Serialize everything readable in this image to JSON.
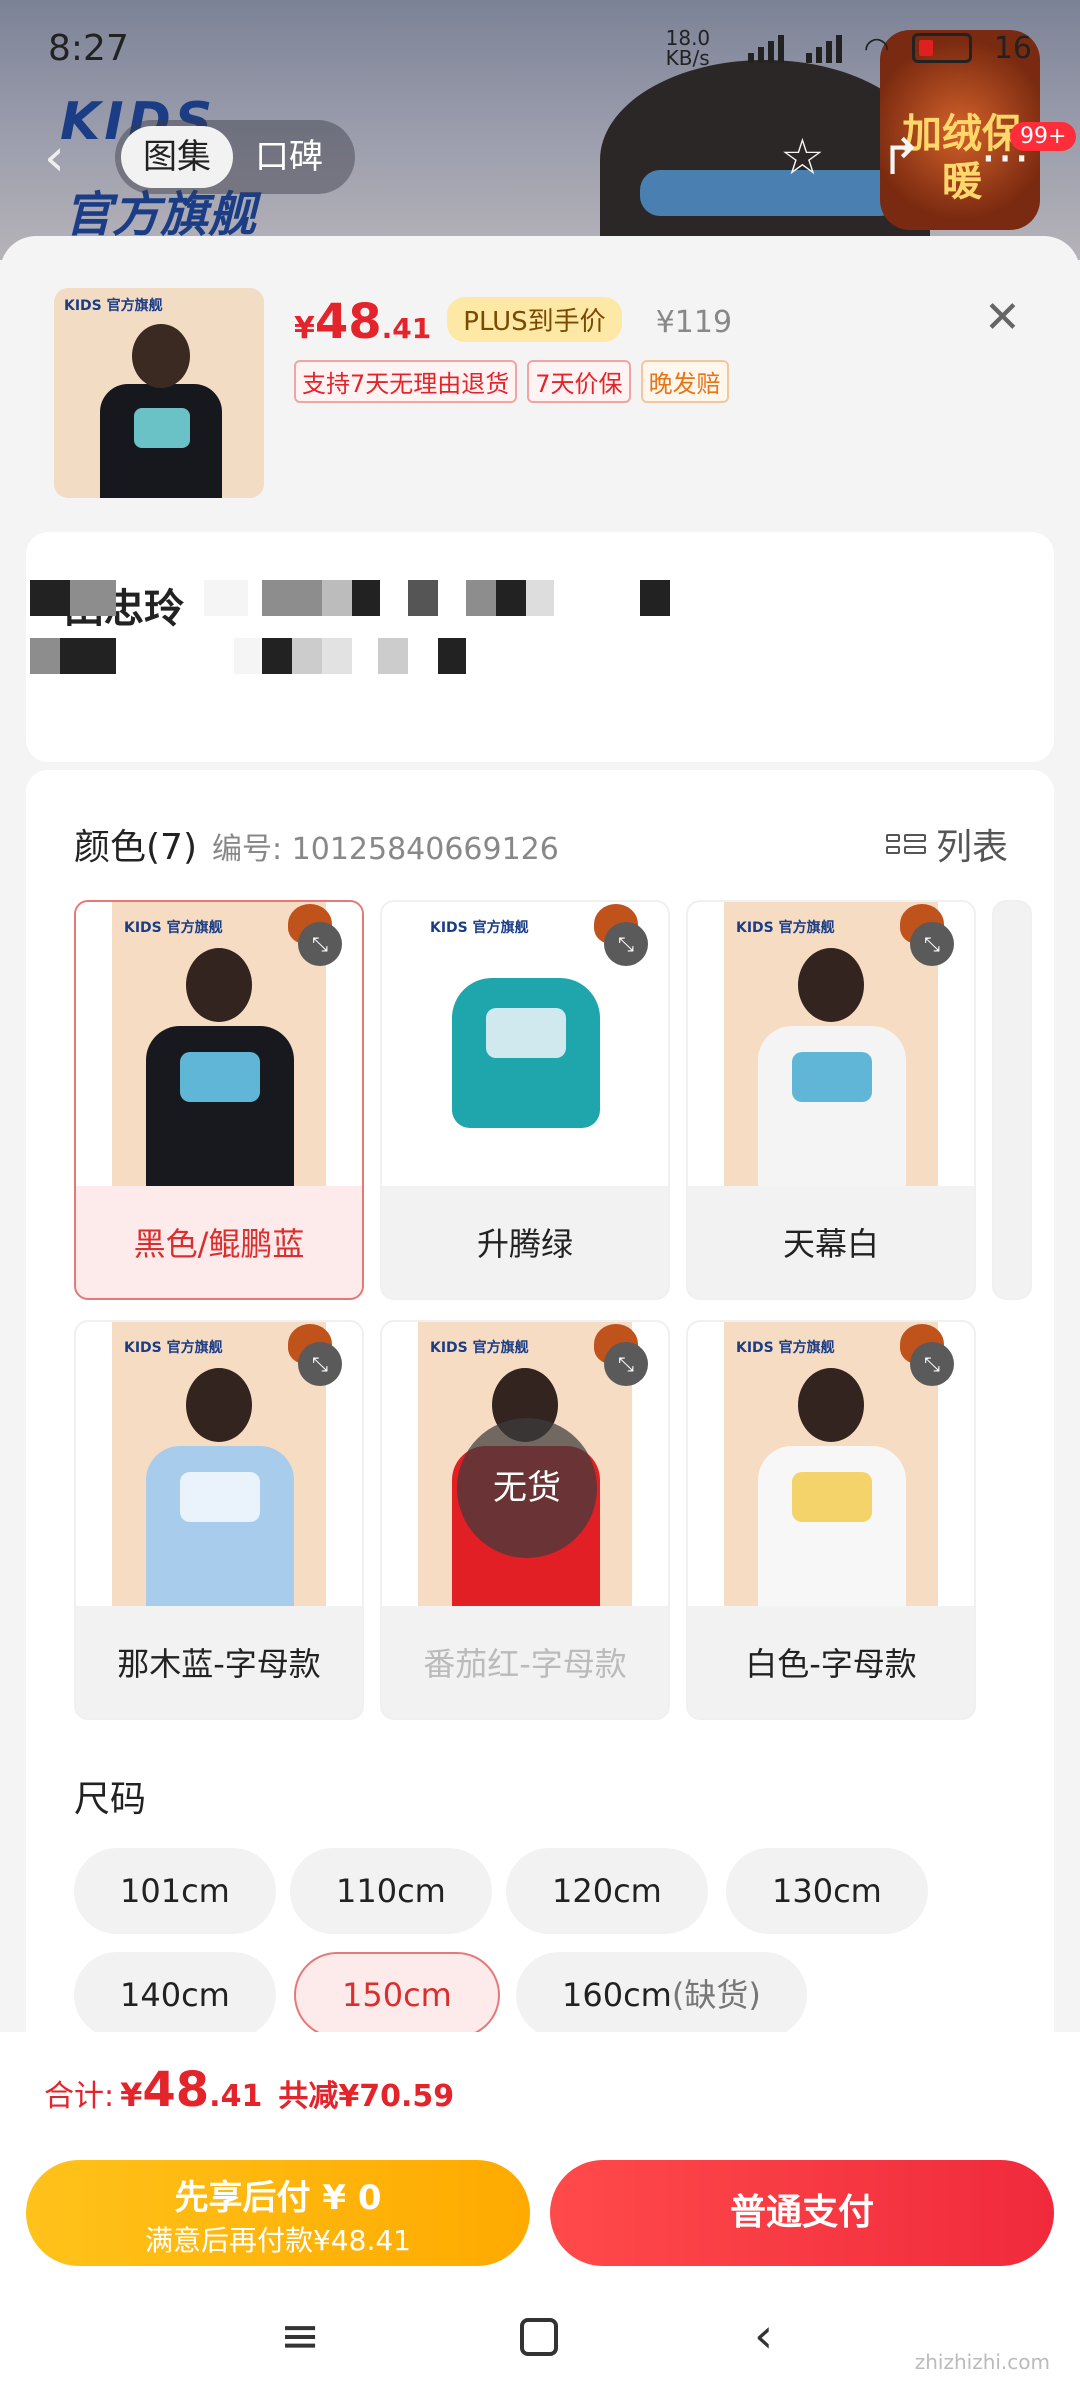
{
  "status_bar": {
    "time": "8:27",
    "net_speed": "18.0 KB/s",
    "battery": "16"
  },
  "top_nav": {
    "tabs": [
      {
        "label": "图集",
        "active": true
      },
      {
        "label": "口碑",
        "active": false
      }
    ],
    "notification_count": "99+",
    "icons": [
      "back-icon",
      "star-icon",
      "share-icon",
      "more-icon"
    ]
  },
  "background_banner": {
    "brand_line1": "KIDS",
    "brand_line2": "官方旗舰",
    "badge_text": "加绒保暖"
  },
  "product": {
    "price_symbol": "¥",
    "price_int": "48",
    "price_dec": ".41",
    "plus_label": "PLUS到手价",
    "original_price": "¥119",
    "tags": [
      "支持7天无理由退货",
      "7天价保",
      "晚发赔"
    ],
    "thumb_brand": "KIDS 官方旗舰"
  },
  "address": {
    "label": "田忠玲"
  },
  "color_section": {
    "title": "颜色(7)",
    "sku_label": "编号: 10125840669126",
    "list_toggle_label": "列表",
    "options": [
      {
        "label": "黑色/鲲鹏蓝",
        "selected": true,
        "available": true,
        "shirt_color": "#17191e"
      },
      {
        "label": "升腾绿",
        "selected": false,
        "available": true,
        "shirt_color": "#1fa6ad"
      },
      {
        "label": "天幕白",
        "selected": false,
        "available": true,
        "shirt_color": "#f4f4f4"
      },
      {
        "label": "那木蓝-字母款",
        "selected": false,
        "available": true,
        "shirt_color": "#a8cdec"
      },
      {
        "label": "番茄红-字母款",
        "selected": false,
        "available": false,
        "shirt_color": "#e21f25"
      },
      {
        "label": "白色-字母款",
        "selected": false,
        "available": true,
        "shirt_color": "#f7f7f7"
      }
    ],
    "out_of_stock_label": "无货",
    "brand_text": "KIDS 官方旗舰"
  },
  "size_section": {
    "title": "尺码",
    "sizes": [
      {
        "label": "101cm",
        "selected": false
      },
      {
        "label": "110cm",
        "selected": false
      },
      {
        "label": "120cm",
        "selected": false
      },
      {
        "label": "130cm",
        "selected": false
      },
      {
        "label": "140cm",
        "selected": false
      },
      {
        "label": "150cm",
        "selected": true
      },
      {
        "label": "160cm",
        "note": "(缺货)",
        "selected": false
      }
    ]
  },
  "footer": {
    "total_label": "合计:",
    "total_symbol": "¥",
    "total_int": "48",
    "total_dec": ".41",
    "save_text": "共减¥70.59",
    "pay_later_line1": "先享后付 ¥ 0",
    "pay_later_line2": "满意后再付款¥48.41",
    "pay_button": "普通支付"
  },
  "watermark": "zhizhizhi.com",
  "colors": {
    "accent_red": "#e3242b",
    "selected_bg": "#fdeaea",
    "pay_later_yellow": "#ffb400"
  }
}
